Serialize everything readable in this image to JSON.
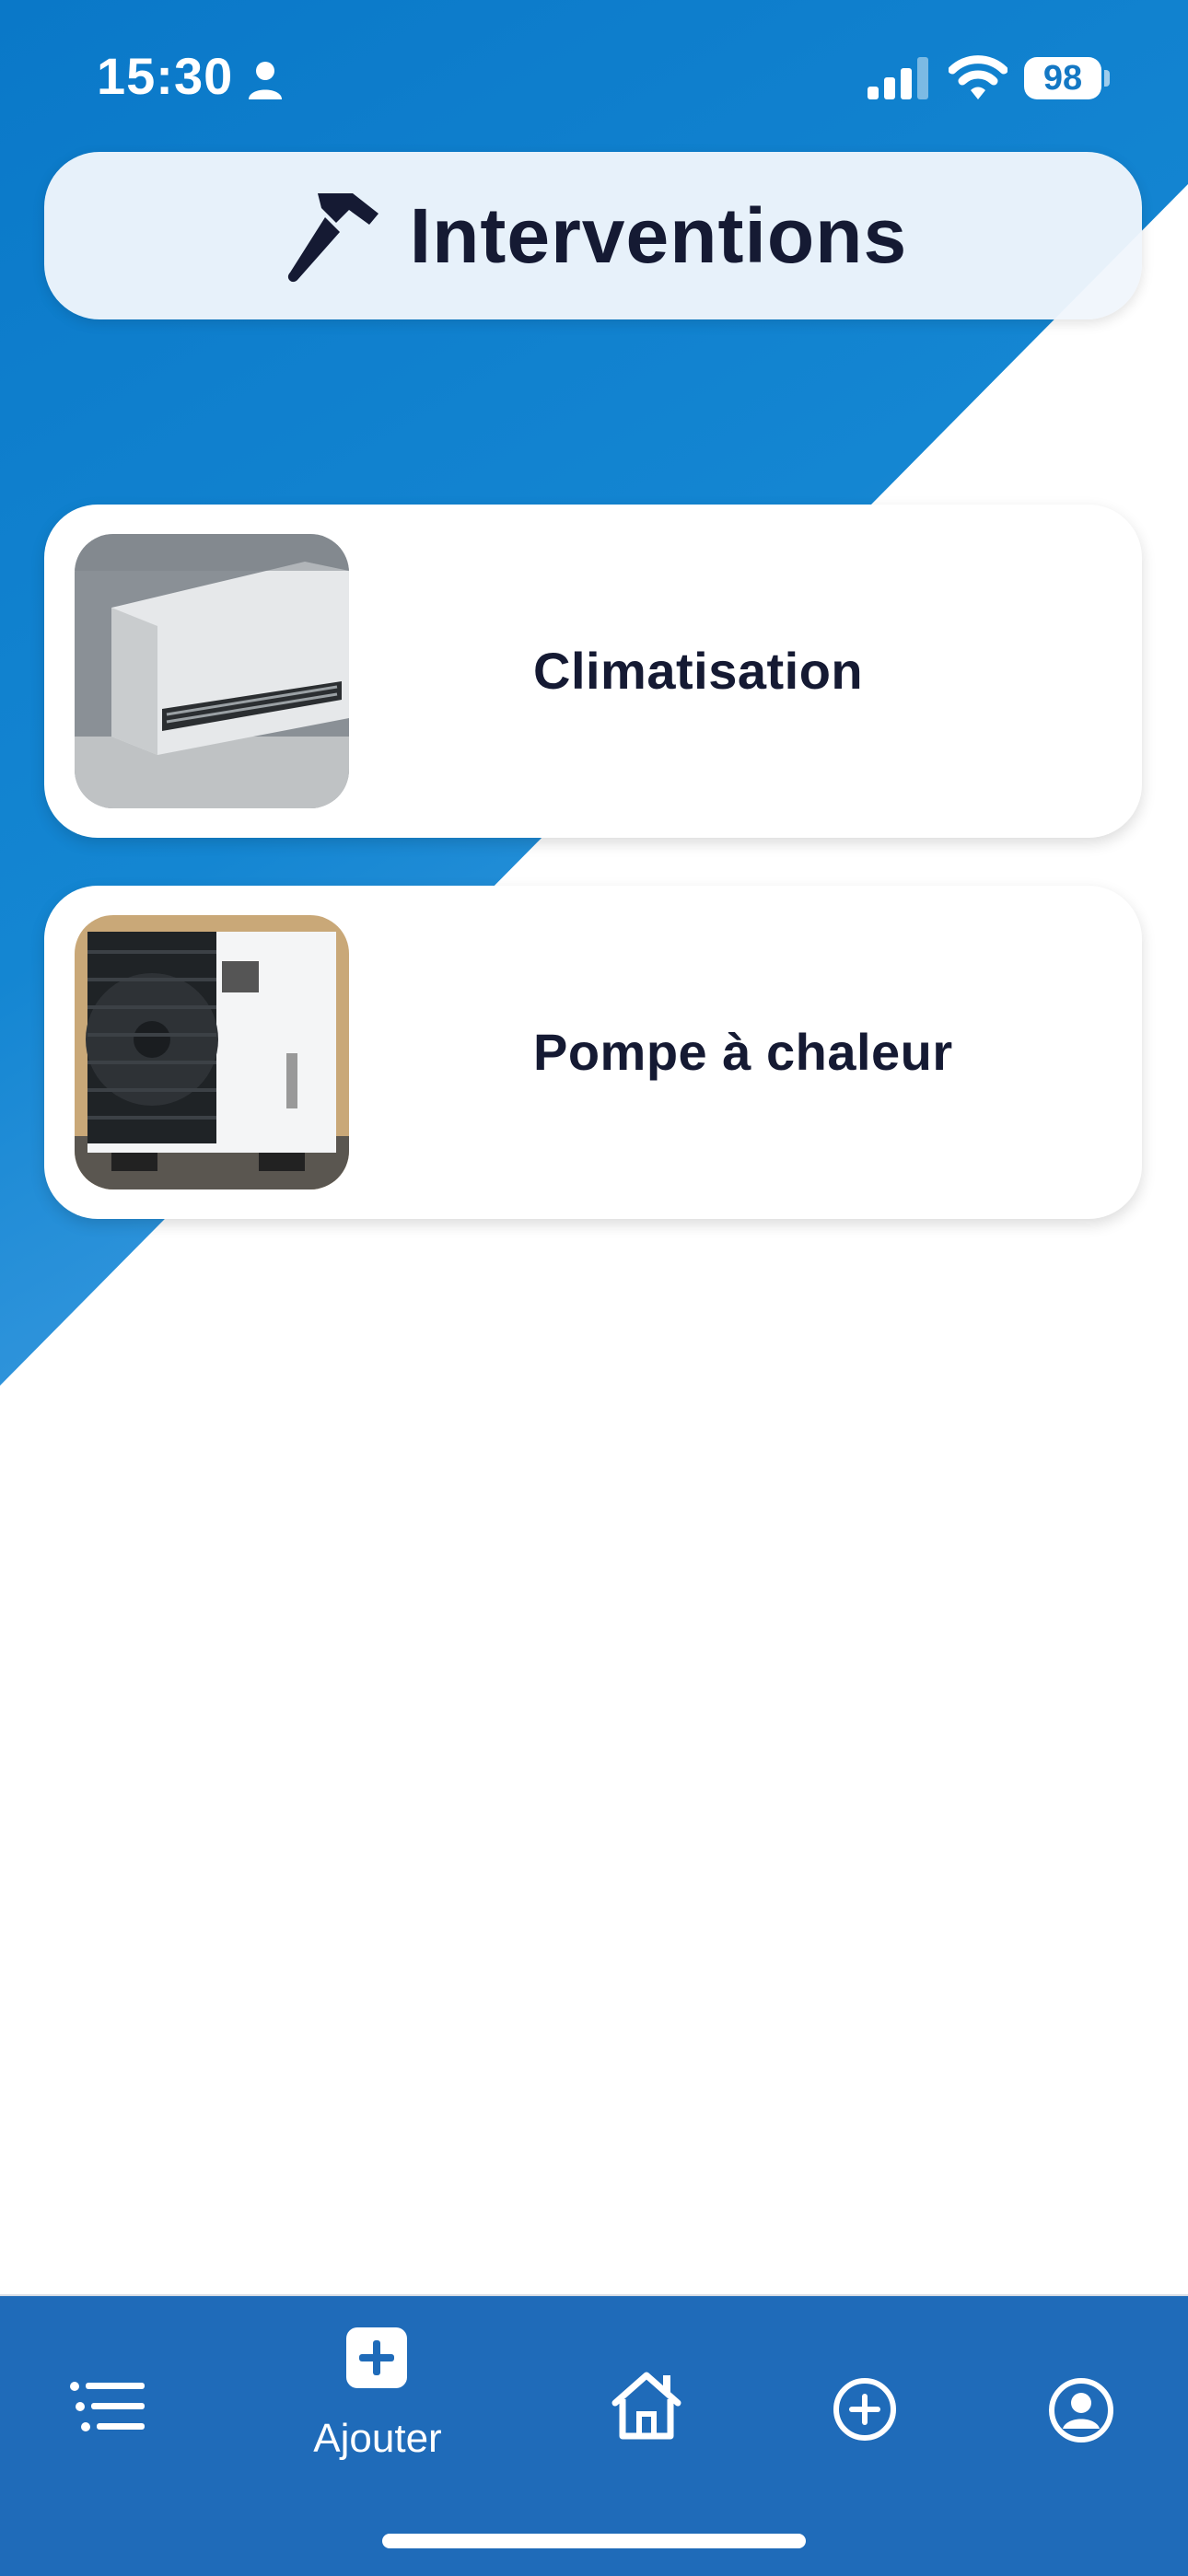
{
  "status_bar": {
    "time": "15:30",
    "battery": "98",
    "icons": [
      "person-icon",
      "signal-icon",
      "wifi-icon"
    ]
  },
  "header": {
    "title": "Interventions",
    "icon": "hammer-icon"
  },
  "cards": [
    {
      "label": "Climatisation",
      "image": "air-conditioner-image"
    },
    {
      "label": "Pompe à chaleur",
      "image": "heat-pump-image"
    }
  ],
  "bottom_nav": {
    "items": [
      {
        "icon": "list-icon"
      },
      {
        "icon": "add-square-icon",
        "label": "Ajouter",
        "active": true
      },
      {
        "icon": "home-icon"
      },
      {
        "icon": "add-circle-icon"
      },
      {
        "icon": "profile-icon"
      }
    ]
  },
  "colors": {
    "primary_blue": "#1478c4",
    "nav_blue": "#1f6bb9",
    "title_text": "#151a33"
  }
}
